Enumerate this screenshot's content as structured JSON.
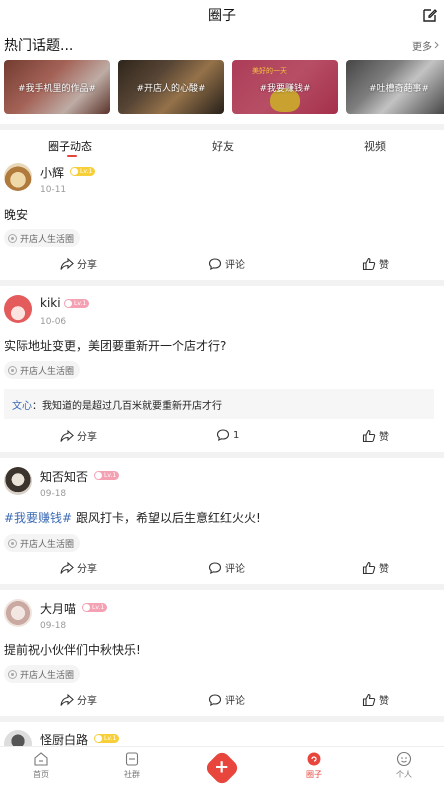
{
  "header": {
    "title": "圈子",
    "edit_icon": "edit-icon"
  },
  "hot": {
    "heading": "热门话题...",
    "more_label": "更多",
    "topics": [
      {
        "label": "#我手机里的作品#"
      },
      {
        "label": "#开店人的心酸#"
      },
      {
        "label": "#我要赚钱#"
      },
      {
        "label": "#吐槽奇葩事#"
      }
    ]
  },
  "topic3_sign": "美好的一天",
  "tabs": [
    {
      "label": "圈子动态",
      "active": true
    },
    {
      "label": "好友",
      "active": false
    },
    {
      "label": "视频",
      "active": false
    }
  ],
  "posts": [
    {
      "name": "小辉",
      "badge": "Lv.1",
      "date": "10-11",
      "content": "晚安",
      "tag": "开店人生活圈",
      "share": "分享",
      "comment": "评论",
      "like": "赞"
    },
    {
      "name": "kiki",
      "badge": "Lv.1",
      "date": "10-06",
      "content": "实际地址变更，美团要重新开一个店才行?",
      "tag": "开店人生活圈",
      "reply_user": "文心",
      "reply_sep": "：",
      "reply_text": "我知道的是超过几百米就要重新开店才行",
      "share": "分享",
      "comment": "1",
      "like": "赞"
    },
    {
      "name": "知否知否",
      "badge": "Lv.1",
      "date": "09-18",
      "hashtag": "#我要赚钱#",
      "content": " 跟风打卡，希望以后生意红红火火!",
      "tag": "开店人生活圈",
      "share": "分享",
      "comment": "评论",
      "like": "赞"
    },
    {
      "name": "大月喵",
      "badge": "Lv.1",
      "date": "09-18",
      "content": "提前祝小伙伴们中秋快乐!",
      "tag": "开店人生活圈",
      "share": "分享",
      "comment": "评论",
      "like": "赞"
    },
    {
      "name": "怪厨白路",
      "badge": "Lv.1"
    }
  ],
  "bottom_nav": [
    {
      "label": "首页",
      "icon": "home-icon"
    },
    {
      "label": "社群",
      "icon": "community-icon"
    },
    {
      "label": "",
      "icon": "plus-icon"
    },
    {
      "label": "圈子",
      "icon": "circle-icon",
      "active": true
    },
    {
      "label": "个人",
      "icon": "profile-icon"
    }
  ],
  "colors": {
    "accent": "#e8453c",
    "link": "#3d6bb5",
    "badge_gold": "#f7cf3a",
    "badge_pink": "#f4a1b4"
  }
}
